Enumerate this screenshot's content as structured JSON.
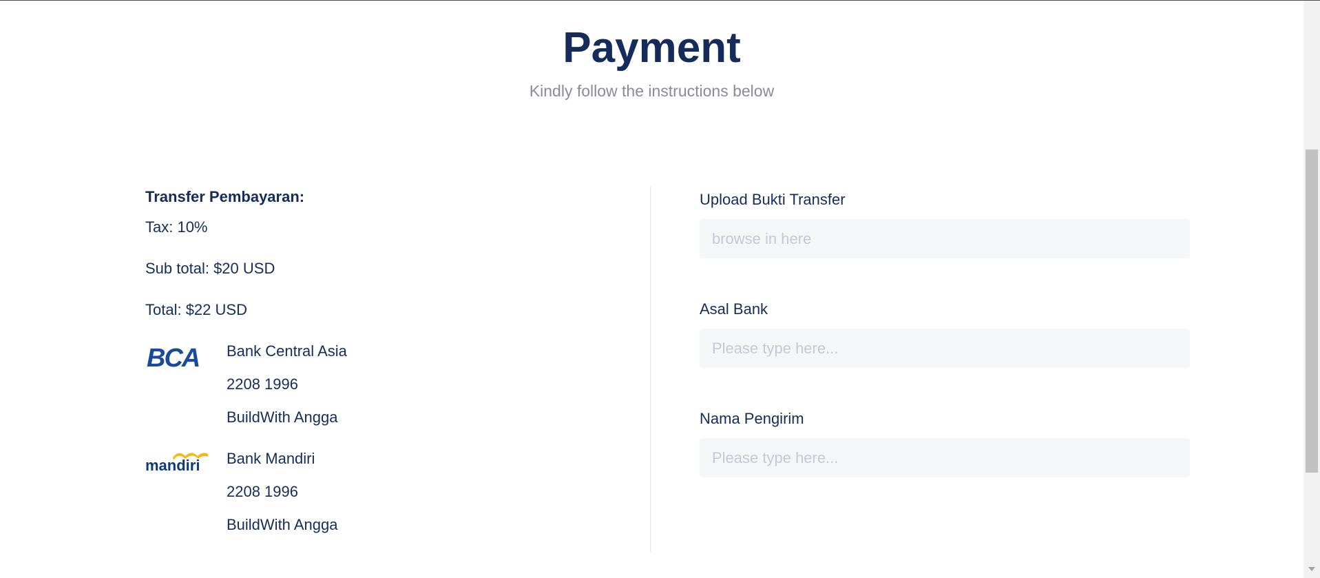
{
  "header": {
    "title": "Payment",
    "subtitle": "Kindly follow the instructions below"
  },
  "summary": {
    "heading": "Transfer Pembayaran:",
    "tax": "Tax: 10%",
    "subtotal": "Sub total: $20 USD",
    "total": "Total: $22 USD"
  },
  "banks": [
    {
      "logo_text": "BCA",
      "name": "Bank Central Asia",
      "account_number": "2208 1996",
      "account_name": "BuildWith Angga"
    },
    {
      "logo_text": "mandiri",
      "name": "Bank Mandiri",
      "account_number": "2208 1996",
      "account_name": "BuildWith Angga"
    }
  ],
  "form": {
    "upload_label": "Upload Bukti Transfer",
    "upload_placeholder": "browse in here",
    "bank_label": "Asal Bank",
    "bank_placeholder": "Please type here...",
    "sender_label": "Nama Pengirim",
    "sender_placeholder": "Please type here..."
  },
  "colors": {
    "primary": "#152c5b",
    "muted": "#8a8a9a",
    "input_bg": "#f5f6f8",
    "bca_blue": "#1a4a9c",
    "mandiri_gold": "#f6b719",
    "mandiri_blue": "#0d3b7a"
  }
}
